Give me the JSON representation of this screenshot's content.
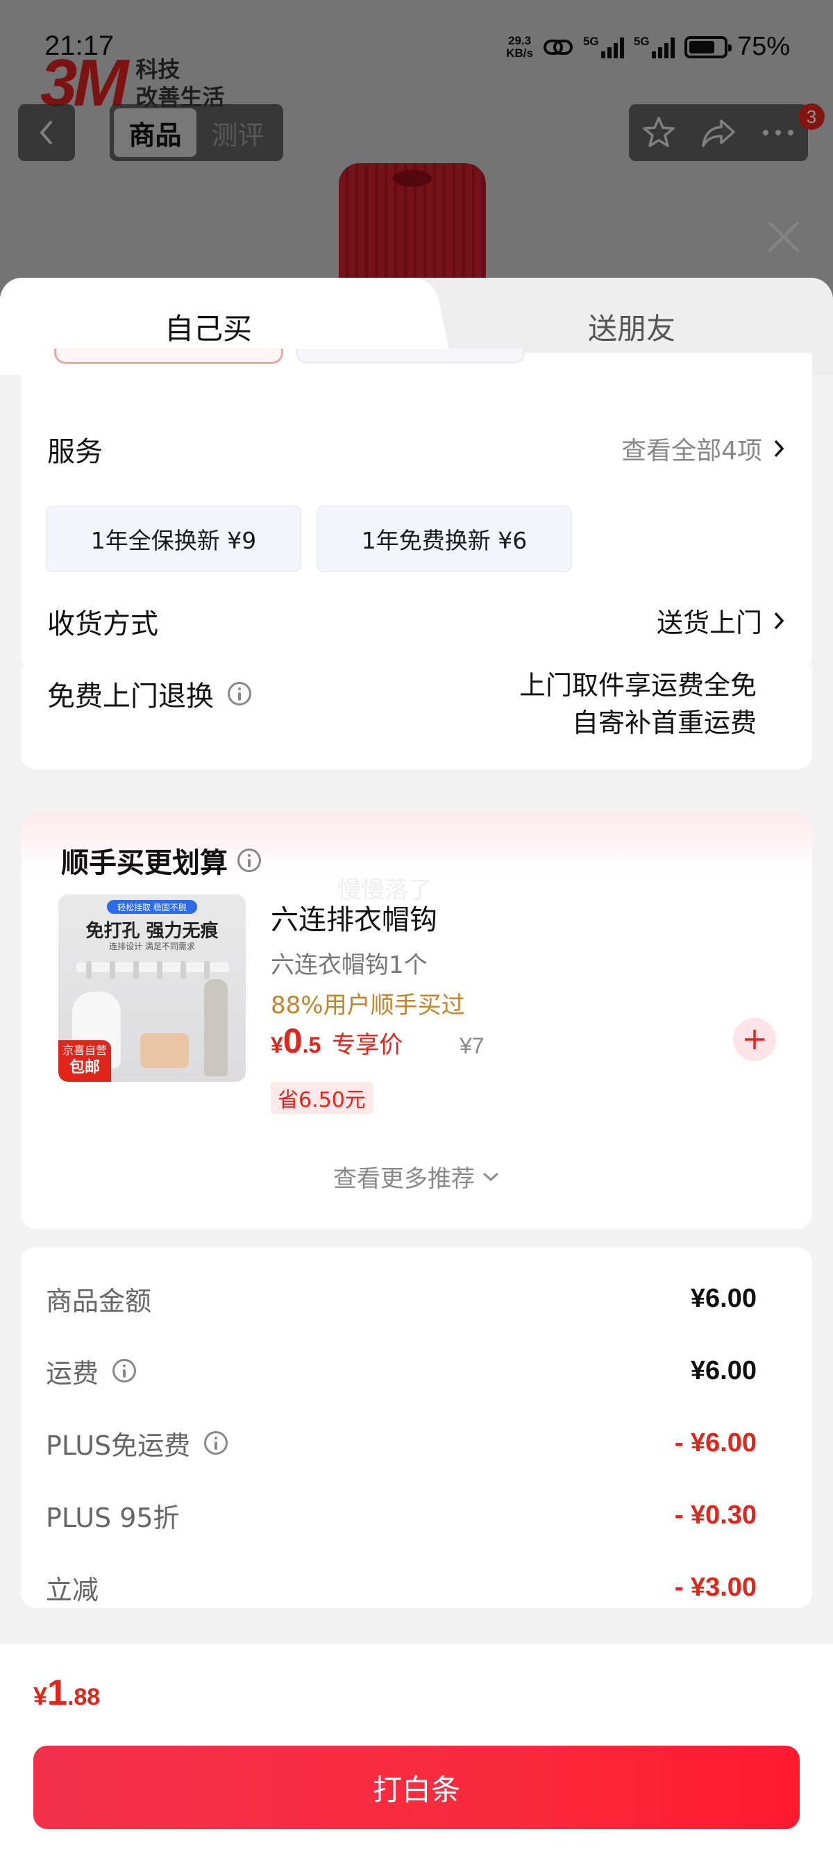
{
  "status_bar": {
    "time": "21:17",
    "net_speed_value": "29.3",
    "net_speed_unit": "KB/s",
    "sim1_label": "5G",
    "sim2_label": "5G",
    "battery_percent": "75%"
  },
  "background": {
    "brand_logo": "3M",
    "brand_slogan_line1": "科技",
    "brand_slogan_line2": "改善生活"
  },
  "top_nav": {
    "tabs": [
      {
        "label": "商品",
        "active": true
      },
      {
        "label": "测评",
        "active": false
      }
    ],
    "cart_badge_count": "3"
  },
  "sheet": {
    "mode_tabs": [
      {
        "label": "自己买",
        "active": true
      },
      {
        "label": "送朋友",
        "active": false
      }
    ],
    "service": {
      "label": "服务",
      "view_all": "查看全部4项",
      "options": [
        {
          "label": "1年全保换新  ¥9"
        },
        {
          "label": "1年免费换新  ¥6"
        }
      ]
    },
    "delivery": {
      "label": "收货方式",
      "value": "送货上门"
    },
    "free_return": {
      "label": "免费上门退换",
      "line1": "上门取件享运费全免",
      "line2": "自寄补首重运费"
    },
    "addon": {
      "title": "顺手买更划算",
      "watermark": "慢慢落了",
      "item": {
        "name": "六连排衣帽钩",
        "spec": "六连衣帽钩1个",
        "social_proof": "88%用户顺手买过",
        "price_currency": "¥",
        "price_int": "0",
        "price_dec": ".5",
        "price_label": "专享价",
        "original_price": "¥7",
        "save_text": "省6.50元",
        "thumb_tag": "轻松挂取 稳固不脱",
        "thumb_headline": "免打孔 强力无痕",
        "thumb_sub": "连排设计 满足不同需求",
        "thumb_badge_line1": "京喜自营",
        "thumb_badge_line2": "包邮"
      },
      "more_label": "查看更多推荐"
    },
    "summary": [
      {
        "label": "商品金额",
        "value": "¥6.00",
        "info": false,
        "negative": false
      },
      {
        "label": "运费",
        "value": "¥6.00",
        "info": true,
        "negative": false
      },
      {
        "label": "PLUS免运费",
        "value": "- ¥6.00",
        "info": true,
        "negative": true
      },
      {
        "label": "PLUS 95折",
        "value": "- ¥0.30",
        "info": false,
        "negative": true
      },
      {
        "label": "立减",
        "value": "- ¥3.00",
        "info": false,
        "negative": true
      }
    ]
  },
  "footer": {
    "total_currency": "¥",
    "total_int": "1",
    "total_dec": ".88",
    "pay_button": "打白条"
  },
  "colors": {
    "accent_red": "#e1251b",
    "social_proof_orange": "#c7832a",
    "pay_gradient_start": "#f2304a",
    "pay_gradient_end": "#ff1a2e"
  },
  "icons": [
    "back-icon",
    "star-icon",
    "share-icon",
    "more-icon",
    "close-icon",
    "chevron-right-icon",
    "info-icon",
    "plus-icon",
    "chevron-down-icon"
  ]
}
